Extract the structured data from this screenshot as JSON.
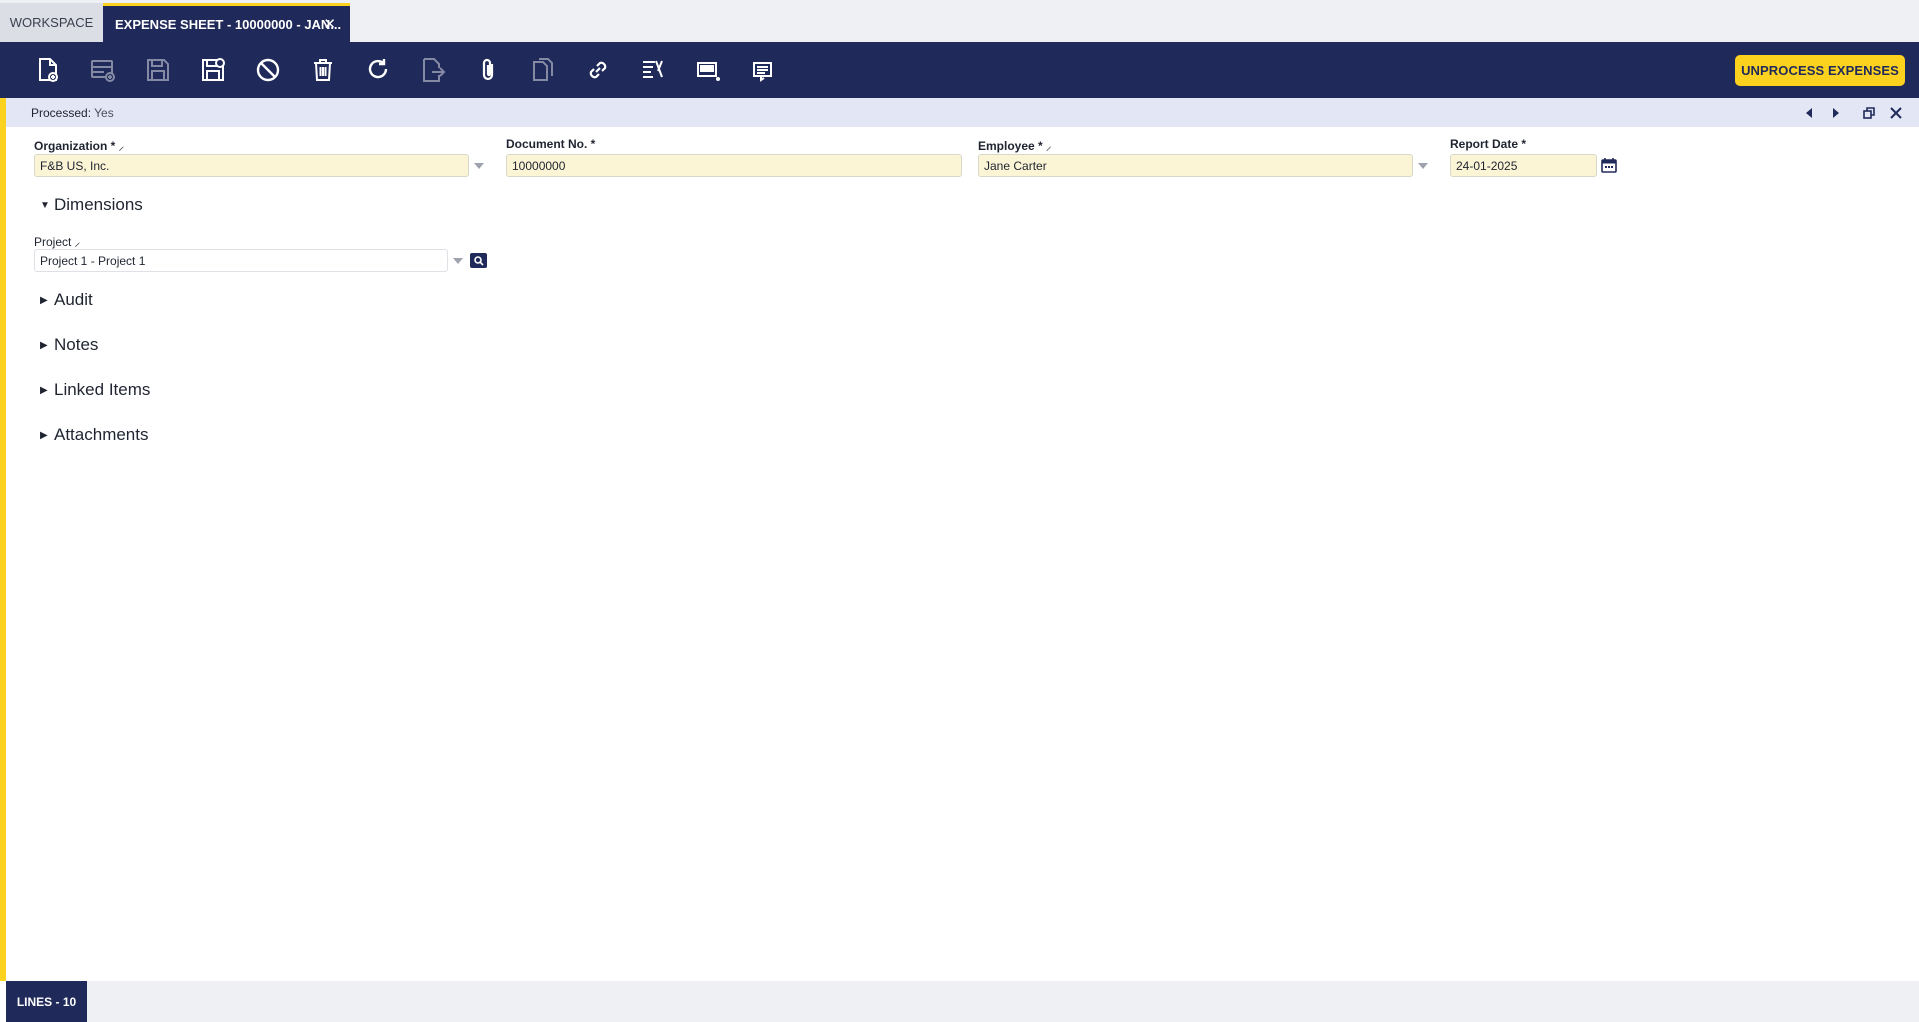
{
  "tabs": {
    "workspace": "WORKSPACE",
    "active": "EXPENSE SHEET - 10000000 - JAN...",
    "close_glyph": "✕"
  },
  "toolbar": {
    "buttons": [
      {
        "icon": "new-document-icon",
        "enabled": true
      },
      {
        "icon": "new-row-icon",
        "enabled": false
      },
      {
        "icon": "save-icon",
        "enabled": false
      },
      {
        "icon": "save-and-close-icon",
        "enabled": true
      },
      {
        "icon": "cancel-icon",
        "enabled": true
      },
      {
        "icon": "delete-icon",
        "enabled": true
      },
      {
        "icon": "refresh-icon",
        "enabled": true
      },
      {
        "icon": "export-icon",
        "enabled": false
      },
      {
        "icon": "attachment-icon",
        "enabled": true
      },
      {
        "icon": "copy-record-icon",
        "enabled": false
      },
      {
        "icon": "link-icon",
        "enabled": true
      },
      {
        "icon": "audit-trail-icon",
        "enabled": true
      },
      {
        "icon": "grid-view-icon",
        "enabled": true
      },
      {
        "icon": "print-icon",
        "enabled": true
      }
    ],
    "action_label": "UNPROCESS EXPENSES"
  },
  "status": {
    "label": "Processed:",
    "value": "Yes"
  },
  "fields": {
    "organization": {
      "label": "Organization *",
      "value": "F&B US, Inc."
    },
    "document_no": {
      "label": "Document No. *",
      "value": "10000000"
    },
    "employee": {
      "label": "Employee *",
      "value": "Jane Carter"
    },
    "report_date": {
      "label": "Report Date *",
      "value": "24-01-2025"
    },
    "project": {
      "label": "Project",
      "value": "Project 1 - Project 1"
    }
  },
  "sections": {
    "dimensions": "Dimensions",
    "audit": "Audit",
    "notes": "Notes",
    "linked_items": "Linked Items",
    "attachments": "Attachments"
  },
  "bottom": {
    "lines_tab": "LINES - 10"
  },
  "colors": {
    "navy": "#202a5a",
    "accent": "#fcd21f",
    "required_field_bg": "#fbf5d6"
  }
}
